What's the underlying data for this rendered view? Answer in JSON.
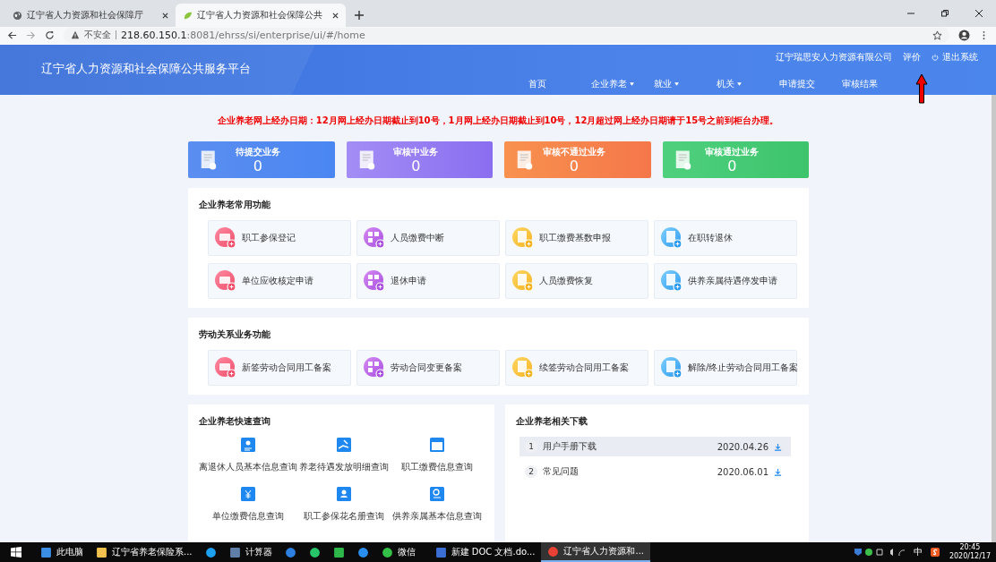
{
  "browser": {
    "tabs": [
      {
        "title": "辽宁省人力资源和社会保障厅",
        "selected": false
      },
      {
        "title": "辽宁省人力资源和社会保障公共",
        "selected": true
      }
    ],
    "address": {
      "warning": "不安全",
      "host": "218.60.150.1",
      "path": ":8081/ehrss/si/enterprise/ui/#/home"
    }
  },
  "header": {
    "title": "辽宁省人力资源和社会保障公共服务平台",
    "company": "辽宁瑞思安人力资源有限公司",
    "rate_link": "评价",
    "logout_link": "退出系统",
    "nav": [
      {
        "label": "首页",
        "dropdown": false
      },
      {
        "label": "企业养老",
        "dropdown": true
      },
      {
        "label": "就业",
        "dropdown": true
      },
      {
        "label": "机关",
        "dropdown": true
      },
      {
        "label": "申请提交",
        "dropdown": false
      },
      {
        "label": "审核结果",
        "dropdown": false
      }
    ]
  },
  "notice": "企业养老网上经办日期：12月网上经办日期截止到10号，1月网上经办日期截止到10号，12月超过网上经办日期请于15号之前到柜台办理。",
  "status_cards": [
    {
      "label": "待提交业务",
      "count": "0",
      "kind": "pending"
    },
    {
      "label": "审核中业务",
      "count": "0",
      "kind": "reviewing"
    },
    {
      "label": "审核不通过业务",
      "count": "0",
      "kind": "rejected"
    },
    {
      "label": "审核通过业务",
      "count": "0",
      "kind": "approved"
    }
  ],
  "sections": [
    {
      "title": "企业养老常用功能",
      "items": [
        {
          "label": "职工参保登记",
          "kind": "pay"
        },
        {
          "label": "人员缴费中断",
          "kind": "grid"
        },
        {
          "label": "职工缴费基数申报",
          "kind": "doc"
        },
        {
          "label": "在职转退休",
          "kind": "list"
        },
        {
          "label": "单位应收核定申请",
          "kind": "pay"
        },
        {
          "label": "退休申请",
          "kind": "grid"
        },
        {
          "label": "人员缴费恢复",
          "kind": "doc"
        },
        {
          "label": "供养亲属待遇停发申请",
          "kind": "list"
        }
      ]
    },
    {
      "title": "劳动关系业务功能",
      "items": [
        {
          "label": "新签劳动合同用工备案",
          "kind": "pay"
        },
        {
          "label": "劳动合同变更备案",
          "kind": "grid"
        },
        {
          "label": "续签劳动合同用工备案",
          "kind": "doc"
        },
        {
          "label": "解除/终止劳动合同用工备案",
          "kind": "list"
        }
      ]
    }
  ],
  "quick_query": {
    "title": "企业养老快速查询",
    "items": [
      {
        "label": "离退休人员基本信息查询",
        "kind": "person"
      },
      {
        "label": "养老待遇发放明细查询",
        "kind": "hand"
      },
      {
        "label": "职工缴费信息查询",
        "kind": "wallet"
      },
      {
        "label": "单位缴费信息查询",
        "kind": "yen"
      },
      {
        "label": "职工参保花名册查询",
        "kind": "book"
      },
      {
        "label": "供养亲属基本信息查询",
        "kind": "search"
      }
    ]
  },
  "downloads": {
    "title": "企业养老相关下载",
    "items": [
      {
        "index": "1",
        "name": "用户手册下载",
        "date": "2020.04.26",
        "selected": true
      },
      {
        "index": "2",
        "name": "常见问题",
        "date": "2020.06.01",
        "selected": false
      }
    ]
  },
  "taskbar": {
    "items": [
      {
        "kind": "computer",
        "label": "此电脑",
        "selected": false
      },
      {
        "kind": "folder",
        "label": "辽宁省养老保险系...",
        "selected": false
      },
      {
        "kind": "ie",
        "selected": false
      },
      {
        "kind": "calc",
        "label": "计算器",
        "selected": false
      },
      {
        "kind": "round",
        "selected": false
      },
      {
        "kind": "play",
        "selected": false
      },
      {
        "kind": "square",
        "selected": false
      },
      {
        "kind": "bird",
        "selected": false
      },
      {
        "kind": "chat",
        "label": "微信",
        "selected": false
      },
      {
        "kind": "doc",
        "label": "新建 DOC 文档.do...",
        "selected": false
      },
      {
        "kind": "chrome",
        "label": "辽宁省人力资源和...",
        "selected": true
      }
    ],
    "ime": "中",
    "time": "20:45",
    "date": "2020/12/17"
  }
}
